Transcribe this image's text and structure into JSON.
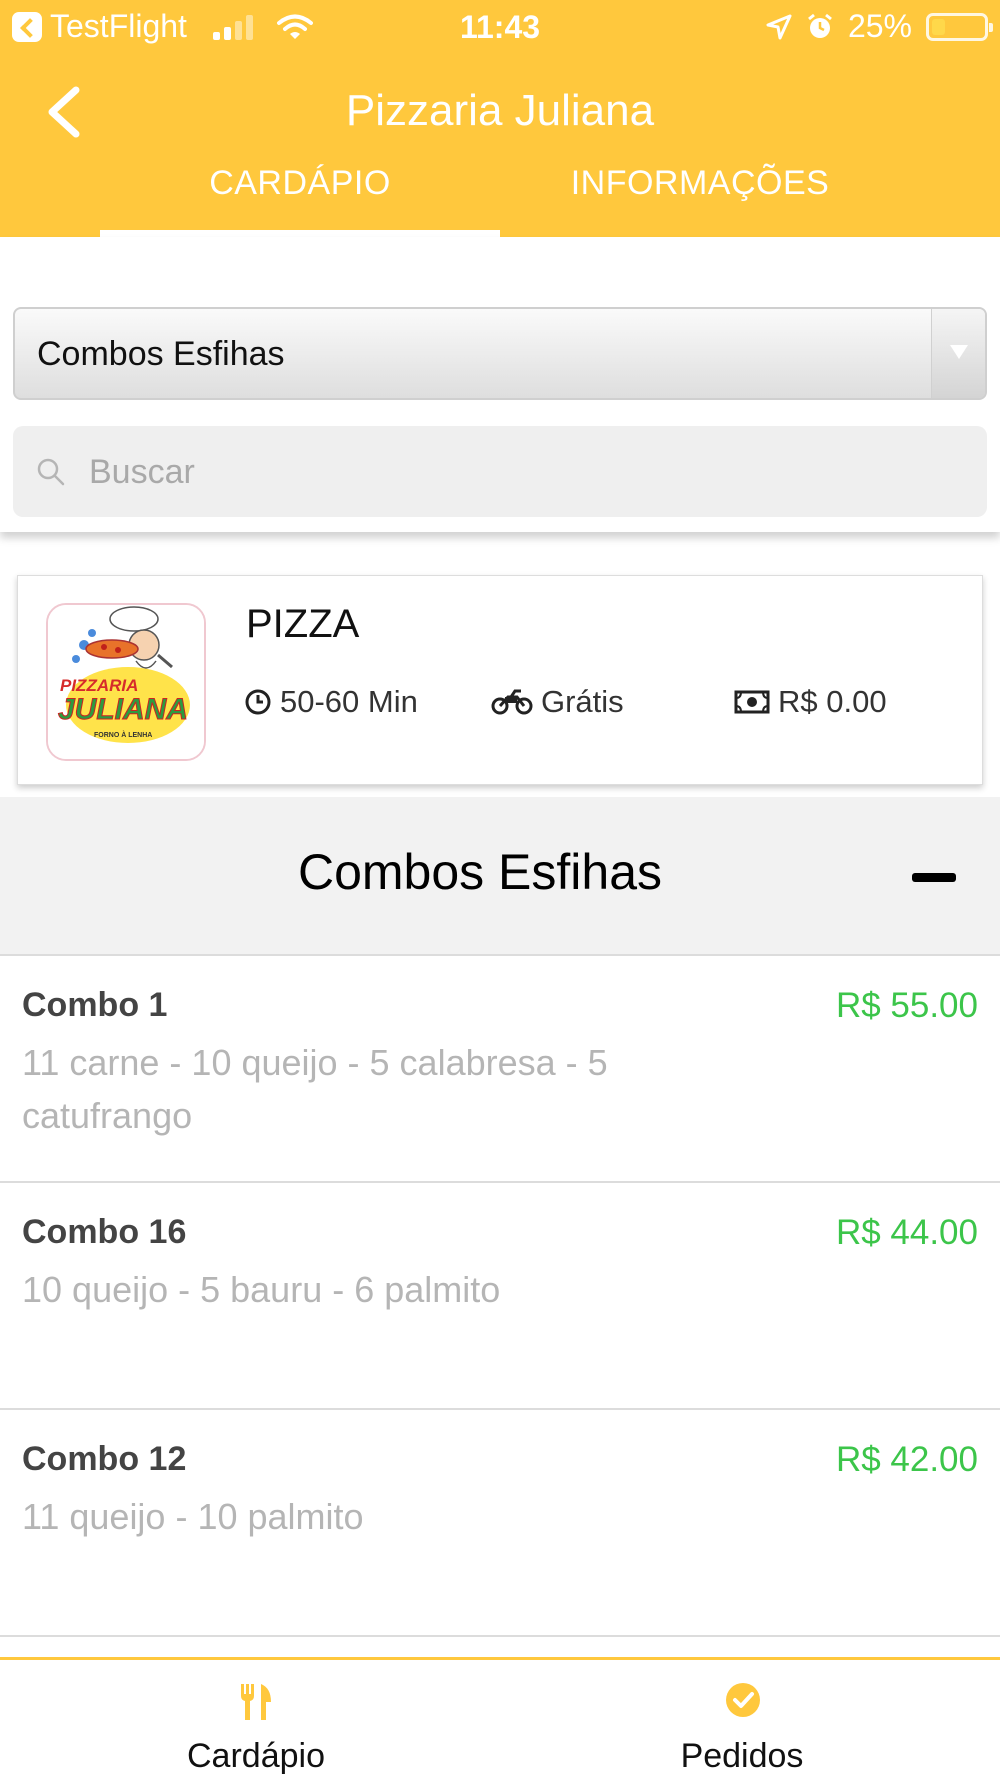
{
  "status_bar": {
    "carrier": "TestFlight",
    "time": "11:43",
    "battery": "25%",
    "battery_level": 0.25
  },
  "header": {
    "title": "Pizzaria Juliana",
    "tabs": [
      {
        "label": "CARDÁPIO",
        "active": true
      },
      {
        "label": "INFORMAÇÕES",
        "active": false
      }
    ]
  },
  "filters": {
    "category_selected": "Combos Esfihas",
    "search_placeholder": "Buscar"
  },
  "store": {
    "name": "PIZZA",
    "delivery_time": "50-60 Min",
    "delivery_fee": "Grátis",
    "min_order": "R$ 0.00",
    "logo": {
      "top_text": "PIZZARIA",
      "main_text": "JULIANA",
      "sub_text": "FORNO À LENHA"
    }
  },
  "section": {
    "title": "Combos Esfihas"
  },
  "products": [
    {
      "name": "Combo 1",
      "description": "11 carne - 10 queijo - 5 calabresa - 5 catufrango",
      "price": "R$ 55.00"
    },
    {
      "name": "Combo 16",
      "description": "10 queijo - 5 bauru - 6 palmito",
      "price": "R$ 44.00"
    },
    {
      "name": "Combo 12",
      "description": "11 queijo - 10 palmito",
      "price": "R$ 42.00"
    }
  ],
  "bottom_nav": [
    {
      "label": "Cardápio",
      "icon": "utensils-icon"
    },
    {
      "label": "Pedidos",
      "icon": "check-circle-icon"
    }
  ],
  "colors": {
    "brand": "#ffc83d",
    "price": "#3cc54a",
    "description": "#b5b5b5"
  }
}
